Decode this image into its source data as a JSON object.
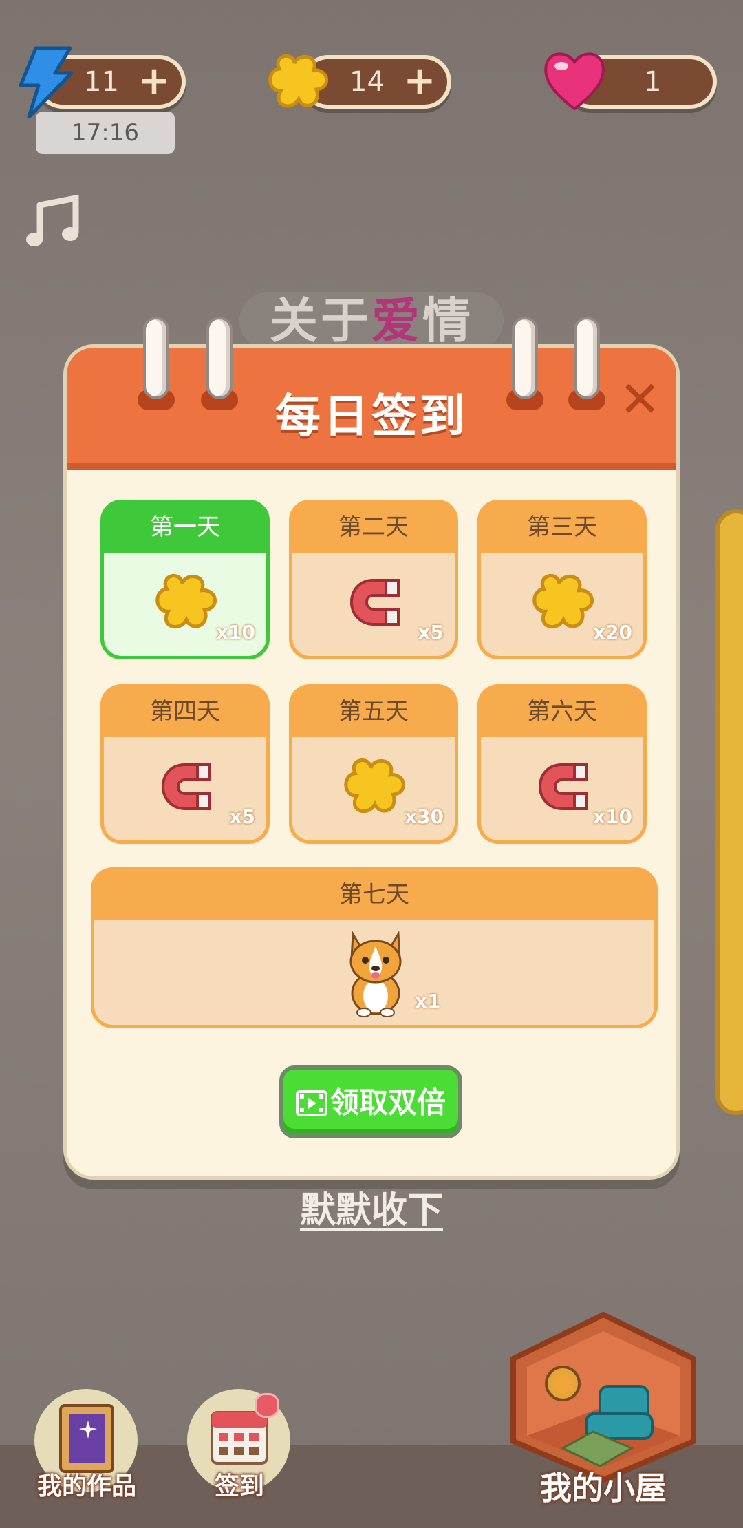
{
  "hud": {
    "energy": {
      "value": "11",
      "plus": "+",
      "timer": "17:16"
    },
    "puzzle": {
      "value": "14",
      "plus": "+"
    },
    "hearts": {
      "value": "1"
    }
  },
  "background_title": {
    "part1": "关于",
    "highlight": "爱",
    "part2": "情"
  },
  "dialog": {
    "title": "每日签到",
    "close_label": "✕",
    "days": [
      {
        "label": "第一天",
        "reward": "puzzle",
        "qty": "x10",
        "status": "claimed"
      },
      {
        "label": "第二天",
        "reward": "magnet",
        "qty": "x5",
        "status": "pending"
      },
      {
        "label": "第三天",
        "reward": "puzzle",
        "qty": "x20",
        "status": "pending"
      },
      {
        "label": "第四天",
        "reward": "magnet",
        "qty": "x5",
        "status": "pending"
      },
      {
        "label": "第五天",
        "reward": "puzzle",
        "qty": "x30",
        "status": "pending"
      },
      {
        "label": "第六天",
        "reward": "magnet",
        "qty": "x10",
        "status": "pending"
      },
      {
        "label": "第七天",
        "reward": "corgi",
        "qty": "x1",
        "status": "pending"
      }
    ],
    "double_button": "领取双倍",
    "quiet_link": "默默收下"
  },
  "bottom_nav": {
    "works": "我的作品",
    "checkin": "签到",
    "house": "我的小屋"
  },
  "colors": {
    "header": "#ed7441",
    "claimed": "#3fc93a",
    "card": "#f7ab4c",
    "button": "#4bdc36"
  }
}
